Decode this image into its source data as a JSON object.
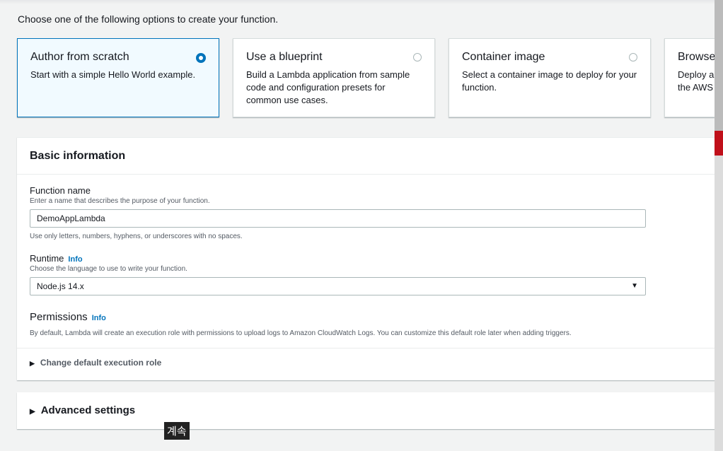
{
  "intro": "Choose one of the following options to create your function.",
  "options": [
    {
      "title": "Author from scratch",
      "desc": "Start with a simple Hello World example.",
      "selected": true
    },
    {
      "title": "Use a blueprint",
      "desc": "Build a Lambda application from sample code and configuration presets for common use cases.",
      "selected": false
    },
    {
      "title": "Container image",
      "desc": "Select a container image to deploy for your function.",
      "selected": false
    },
    {
      "title": "Browse serverless app repository",
      "desc": "Deploy a sample Lambda application from the AWS Serverless Application Repository.",
      "selected": false
    }
  ],
  "basic": {
    "header": "Basic information",
    "function_name": {
      "label": "Function name",
      "hint": "Enter a name that describes the purpose of your function.",
      "value": "DemoAppLambda",
      "constraint": "Use only letters, numbers, hyphens, or underscores with no spaces."
    },
    "runtime": {
      "label": "Runtime",
      "info": "Info",
      "hint": "Choose the language to use to write your function.",
      "value": "Node.js 14.x"
    },
    "permissions": {
      "title": "Permissions",
      "info": "Info",
      "desc": "By default, Lambda will create an execution role with permissions to upload logs to Amazon CloudWatch Logs. You can customize this default role later when adding triggers."
    },
    "execution_role": "Change default execution role"
  },
  "advanced": "Advanced settings",
  "caption": "계속"
}
